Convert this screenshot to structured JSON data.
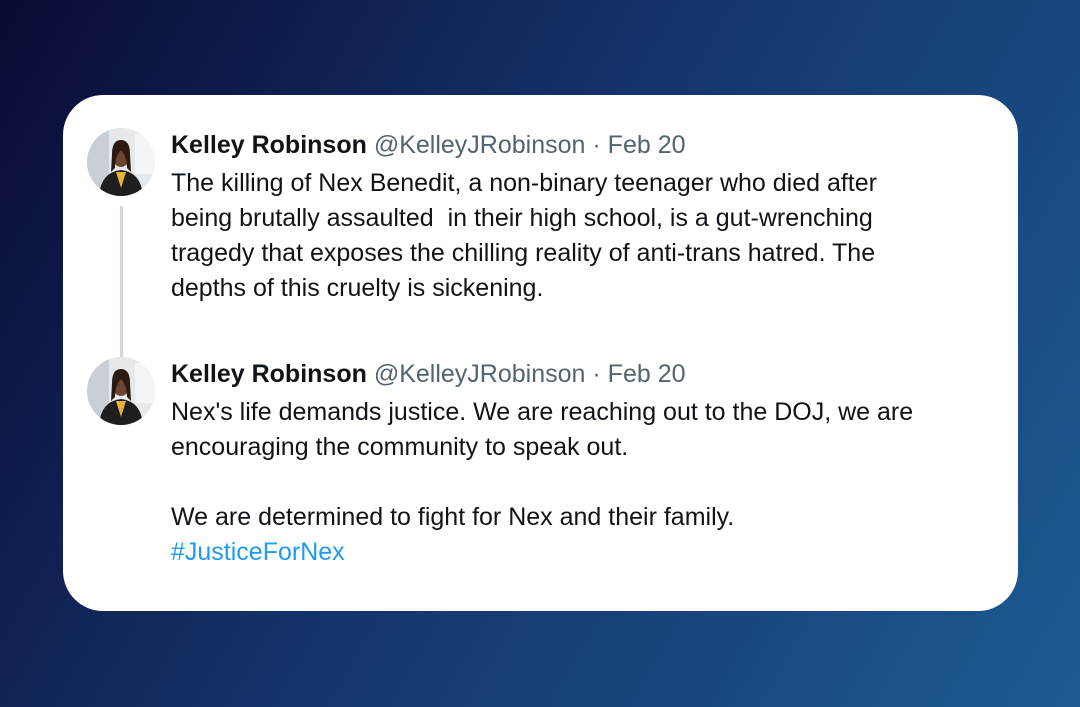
{
  "tweets": [
    {
      "name": "Kelley Robinson",
      "handle": "@KelleyJRobinson",
      "separator": "·",
      "date": "Feb 20",
      "text": "The killing of Nex Benedit, a non-binary teenager who died after\nbeing brutally assaulted  in their high school, is a gut-wrenching\ntragedy that exposes the chilling reality of anti-trans hatred. The\ndepths of this cruelty is sickening."
    },
    {
      "name": "Kelley Robinson",
      "handle": "@KelleyJRobinson",
      "separator": "·",
      "date": "Feb 20",
      "text": "Nex's life demands justice. We are reaching out to the DOJ, we are\nencouraging the community to speak out.\n\nWe are determined to fight for Nex and their family.",
      "hashtag": "#JusticeForNex"
    }
  ],
  "colors": {
    "hashtag": "#1d9bf0",
    "thread_line": "#cfd9de",
    "secondary_text": "#536471",
    "primary_text": "#0f1419"
  }
}
